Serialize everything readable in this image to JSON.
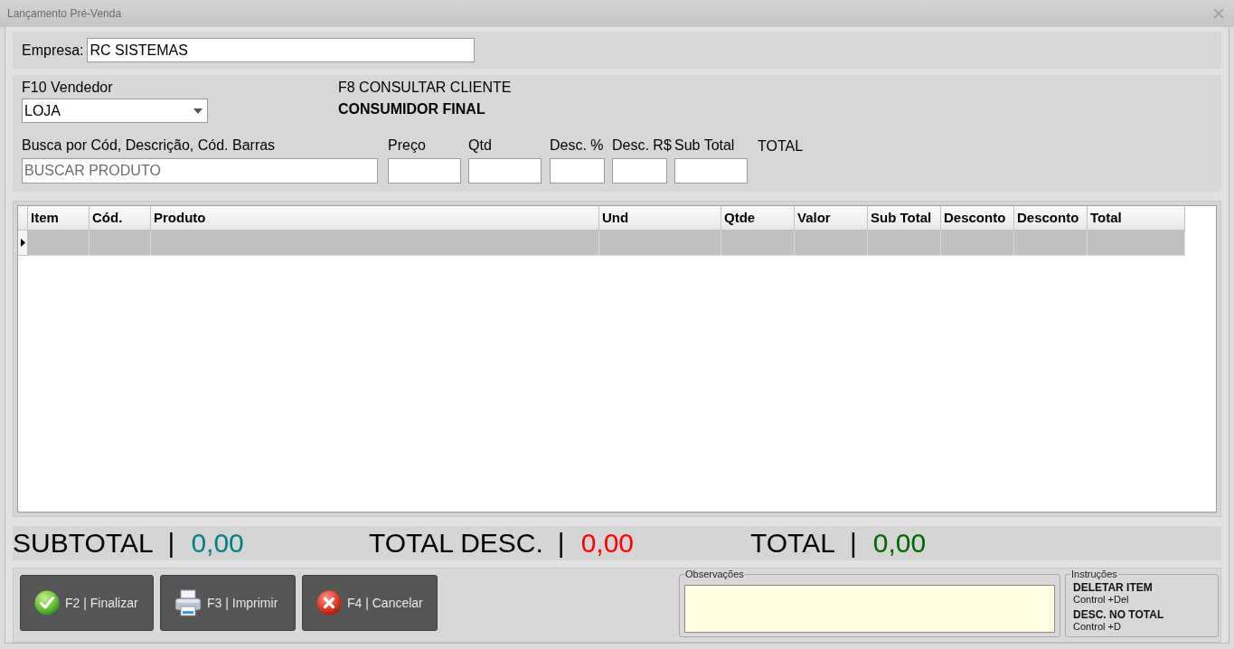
{
  "window": {
    "title": "Lançamento Pré-Venda"
  },
  "empresa": {
    "label": "Empresa:",
    "value": "RC SISTEMAS"
  },
  "vendedor": {
    "label": "F10 Vendedor",
    "value": "LOJA"
  },
  "cliente": {
    "label": "F8 CONSULTAR CLIENTE",
    "name": "CONSUMIDOR FINAL"
  },
  "product_entry": {
    "fields": [
      {
        "label": "Busca por Cód, Descrição, Cód. Barras",
        "placeholder": "BUSCAR PRODUTO"
      },
      {
        "label": "Preço"
      },
      {
        "label": "Qtd"
      },
      {
        "label": "Desc. %"
      },
      {
        "label": "Desc. R$"
      },
      {
        "label": "Sub Total"
      }
    ],
    "total_label": "TOTAL"
  },
  "table": {
    "columns": [
      "Item",
      "Cód.",
      "Produto",
      "Und",
      "Qtde",
      "Valor",
      "Sub Total",
      "Desconto",
      "Desconto",
      "Total"
    ],
    "rows": [
      {
        "selected": true
      }
    ]
  },
  "totals": [
    {
      "label": "SUBTOTAL",
      "separator": "|",
      "value": "0,00",
      "color": "#008080"
    },
    {
      "label": "TOTAL DESC.",
      "separator": "|",
      "value": "0,00",
      "color": "#ff0000"
    },
    {
      "label": "TOTAL",
      "separator": "|",
      "value": "0,00",
      "color": "#006400"
    }
  ],
  "buttons": [
    {
      "label": "F2 | Finalizar",
      "kind": "confirm"
    },
    {
      "label": "F3 | Imprimir",
      "kind": "print"
    },
    {
      "label": "F4 | Cancelar",
      "kind": "cancel"
    }
  ],
  "observacoes": {
    "label": "Observações"
  },
  "instrucoes": {
    "label": "Instruções",
    "items": [
      {
        "title": "DELETAR ITEM",
        "shortcut": "Control +Del"
      },
      {
        "title": "DESC. NO TOTAL",
        "shortcut": "Control +D"
      }
    ]
  }
}
